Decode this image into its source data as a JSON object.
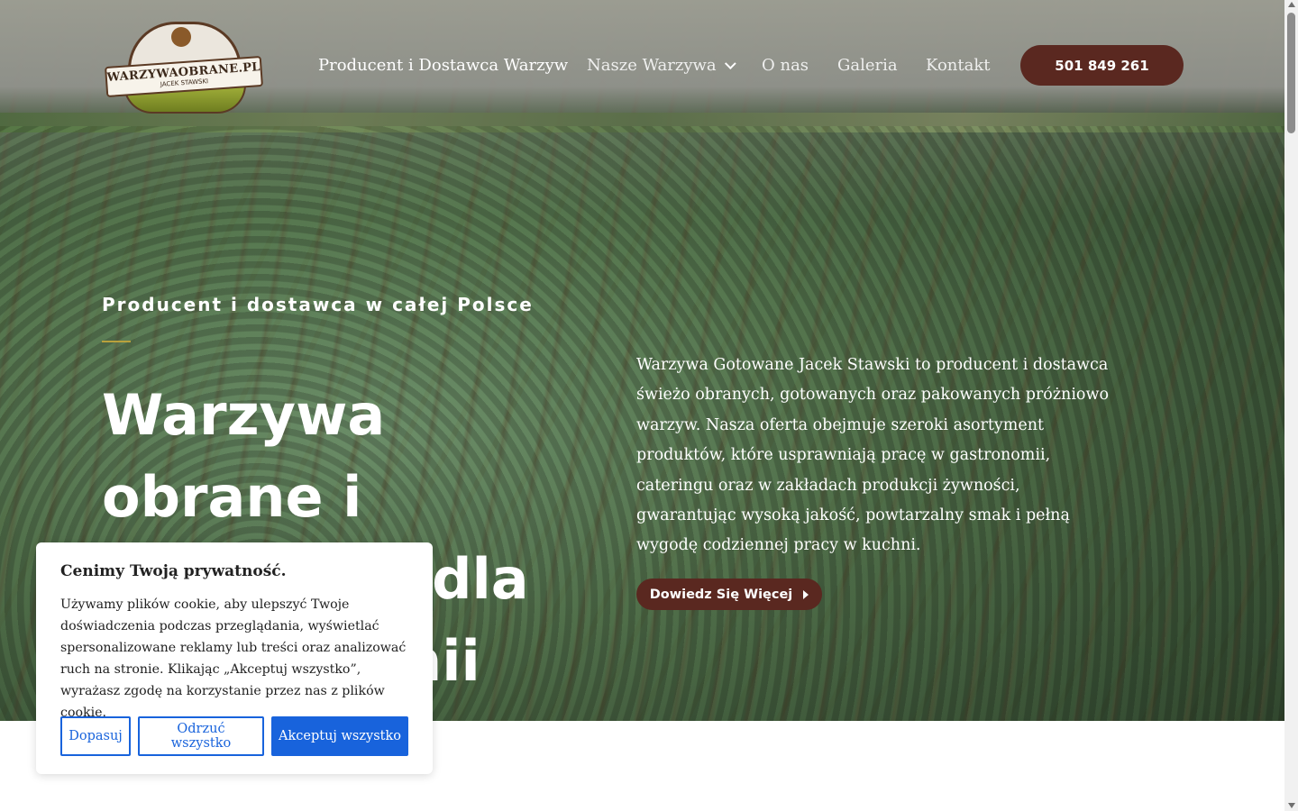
{
  "header": {
    "logo": {
      "title": "WARZYWAOBRANE.PL",
      "subtitle": "JACEK STAWSKI"
    },
    "nav": [
      {
        "label": "Producent i Dostawca Warzyw"
      },
      {
        "label": "Nasze Warzywa"
      },
      {
        "label": "O nas"
      },
      {
        "label": "Galeria"
      },
      {
        "label": "Kontakt"
      }
    ],
    "phone": "501 849 261"
  },
  "hero": {
    "eyebrow": "Producent i dostawca w całej Polsce",
    "headline": "Warzywa obrane i gotowane dla gastronomii",
    "description": "Warzywa Gotowane Jacek Stawski to producent i dostawca świeżo obranych, gotowanych oraz pakowanych próżniowo warzyw. Nasza oferta obejmuje szeroki asortyment produktów, które usprawniają pracę w gastronomii, cateringu oraz w zakładach produkcji żywności, gwarantując wysoką jakość, powtarzalny smak i pełną wygodę codziennej pracy w kuchni.",
    "cta": "Dowiedz Się Więcej"
  },
  "cookie": {
    "title": "Cenimy Twoją prywatność.",
    "text": "Używamy plików cookie, aby ulepszyć Twoje doświadczenia podczas przeglądania, wyświetlać spersonalizowane reklamy lub treści oraz analizować ruch na stronie. Klikając „Akceptuj wszystko”, wyrażasz zgodę na korzystanie przez nas z plików cookie.",
    "buttons": {
      "customize": "Dopasuj",
      "reject": "Odrzuć wszystko",
      "accept": "Akceptuj wszystko"
    }
  },
  "colors": {
    "brand_brown": "#5a2820",
    "cookie_blue": "#1863dc",
    "accent_gold": "#b9a13c"
  }
}
